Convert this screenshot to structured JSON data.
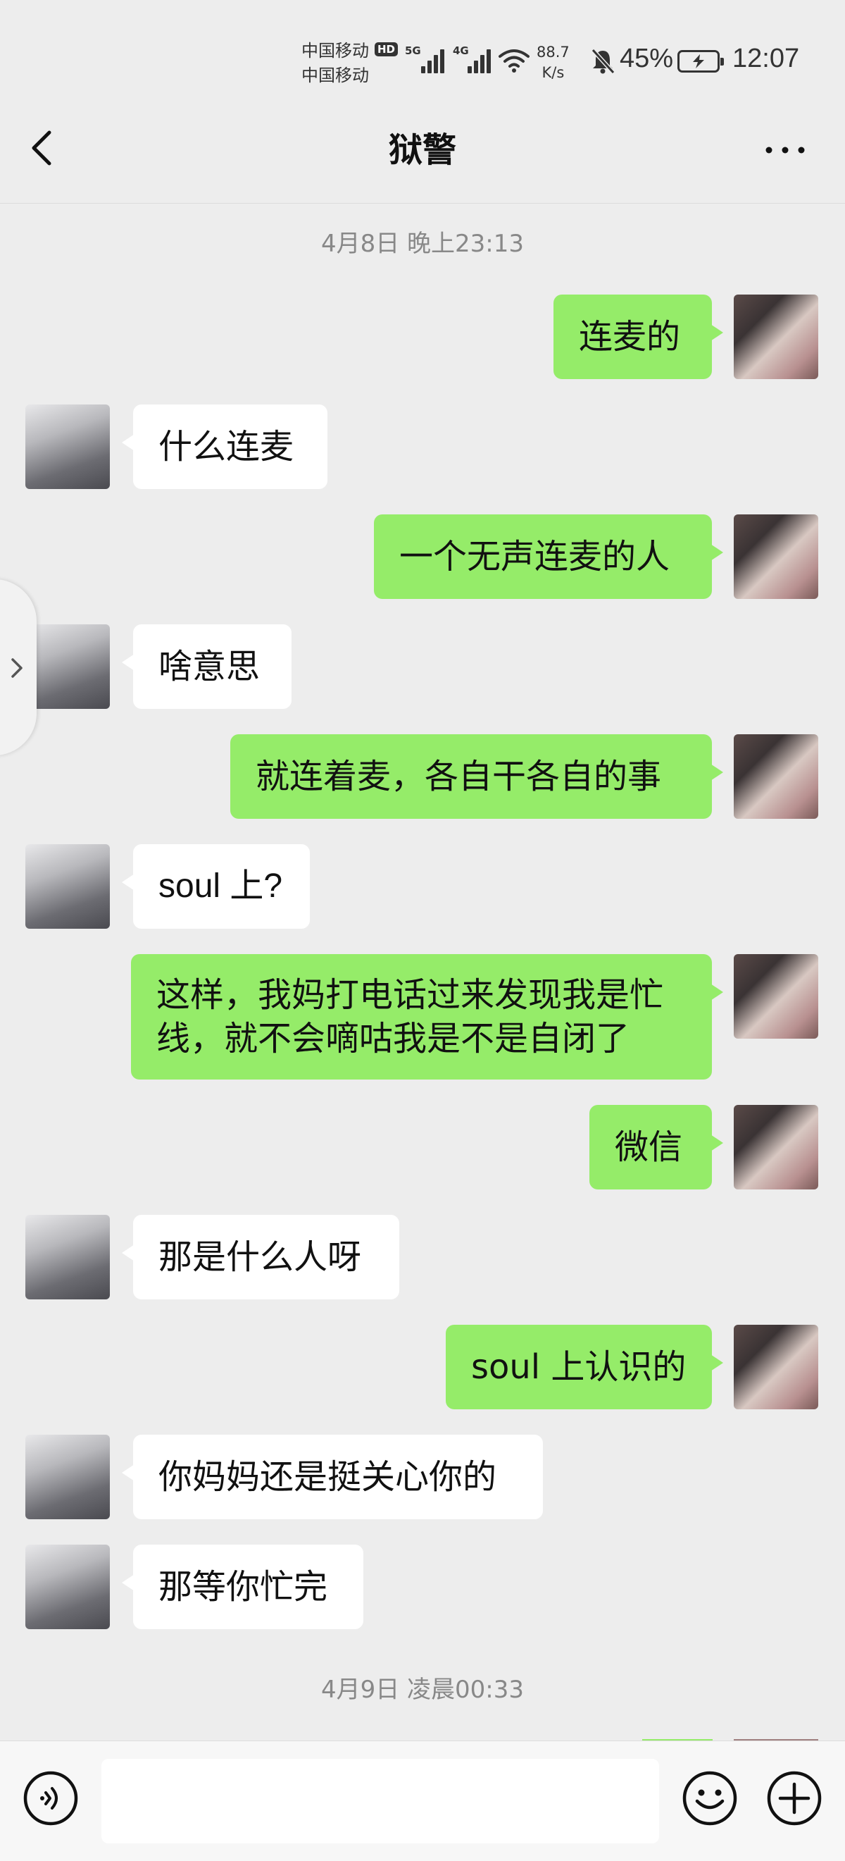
{
  "status_bar": {
    "carrier_1": "中国移动",
    "carrier_2": "中国移动",
    "hd": "HD",
    "net_1": "5G",
    "net_2": "4G",
    "speed_value": "88.7",
    "speed_unit": "K/s",
    "battery": "45%",
    "time": "12:07",
    "icons": [
      "signal-icon",
      "wifi-icon",
      "mute-bell-icon",
      "battery-icon"
    ]
  },
  "nav": {
    "title": "狱警",
    "back_icon": "chevron-left-icon",
    "more_icon": "more-dots-icon"
  },
  "timestamps": [
    "4月8日 晚上23:13",
    "4月9日 凌晨00:33"
  ],
  "messages": [
    {
      "from": "self",
      "text": "连麦的"
    },
    {
      "from": "other",
      "text": "什么连麦"
    },
    {
      "from": "self",
      "text": "一个无声连麦的人"
    },
    {
      "from": "other",
      "text": "啥意思"
    },
    {
      "from": "self",
      "text": "就连着麦，各自干各自的事"
    },
    {
      "from": "other",
      "text": "soul 上?"
    },
    {
      "from": "self",
      "text": "这样，我妈打电话过来发现我是忙\n线，就不会嘀咕我是不是自闭了"
    },
    {
      "from": "self",
      "text": "微信"
    },
    {
      "from": "other",
      "text": "那是什么人呀"
    },
    {
      "from": "self",
      "text": "soul 上认识的"
    },
    {
      "from": "other",
      "text": "你妈妈还是挺关心你的"
    },
    {
      "from": "other",
      "text": "那等你忙完"
    }
  ],
  "input_bar": {
    "voice_icon": "voice-icon",
    "emoji_icon": "emoji-icon",
    "plus_icon": "plus-icon",
    "input_value": ""
  },
  "colors": {
    "background": "#EDEDED",
    "self_bubble": "#95EC69",
    "other_bubble": "#FFFFFF",
    "timestamp_text": "#888888"
  }
}
